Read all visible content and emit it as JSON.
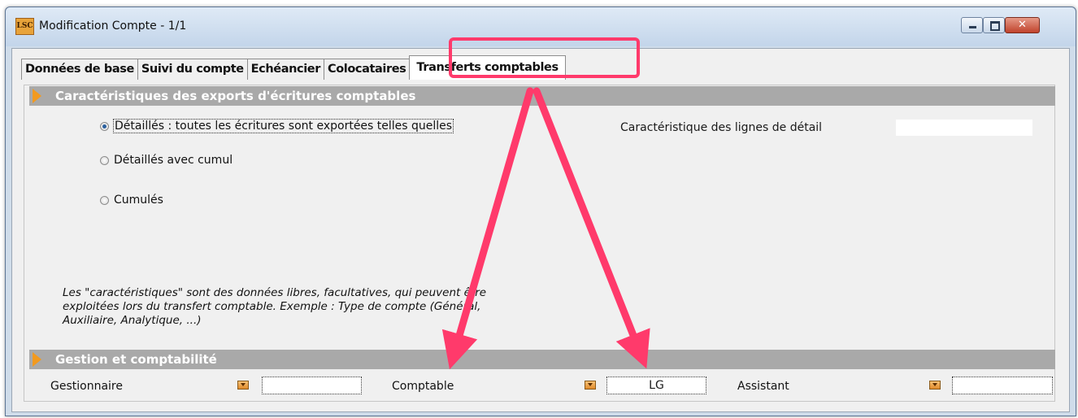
{
  "window": {
    "logo_text": "LSC",
    "title": "Modification Compte - 1/1",
    "controls": {
      "minimize": "minimize",
      "maximize": "maximize",
      "close": "close"
    }
  },
  "tabs": [
    {
      "label": "Données de base",
      "active": false
    },
    {
      "label": "Suivi du compte",
      "active": false
    },
    {
      "label": "Echéancier",
      "active": false
    },
    {
      "label": "Colocataires",
      "active": false
    },
    {
      "label": "Transferts comptables",
      "active": true
    }
  ],
  "export_section": {
    "title": "Caractéristiques des exports d'écritures comptables",
    "options": [
      {
        "label": "Détaillés : toutes les écritures sont exportées telles quelles",
        "checked": true
      },
      {
        "label": "Détaillés avec cumul",
        "checked": false
      },
      {
        "label": "Cumulés",
        "checked": false
      }
    ],
    "detail_label": "Caractéristique des lignes de détail",
    "detail_value": "",
    "note_lines": [
      "Les \"caractéristiques\" sont des données libres, facultatives, qui peuvent être",
      "exploitées lors du transfert comptable. Exemple : Type de compte (Général,",
      "Auxiliaire, Analytique, ...)"
    ]
  },
  "gestion_section": {
    "title": "Gestion et comptabilité",
    "fields": [
      {
        "label": "Gestionnaire",
        "value": ""
      },
      {
        "label": "Comptable",
        "value": "LG"
      },
      {
        "label": "Assistant",
        "value": ""
      }
    ]
  },
  "annotation": {
    "color": "#ff3a6b"
  }
}
